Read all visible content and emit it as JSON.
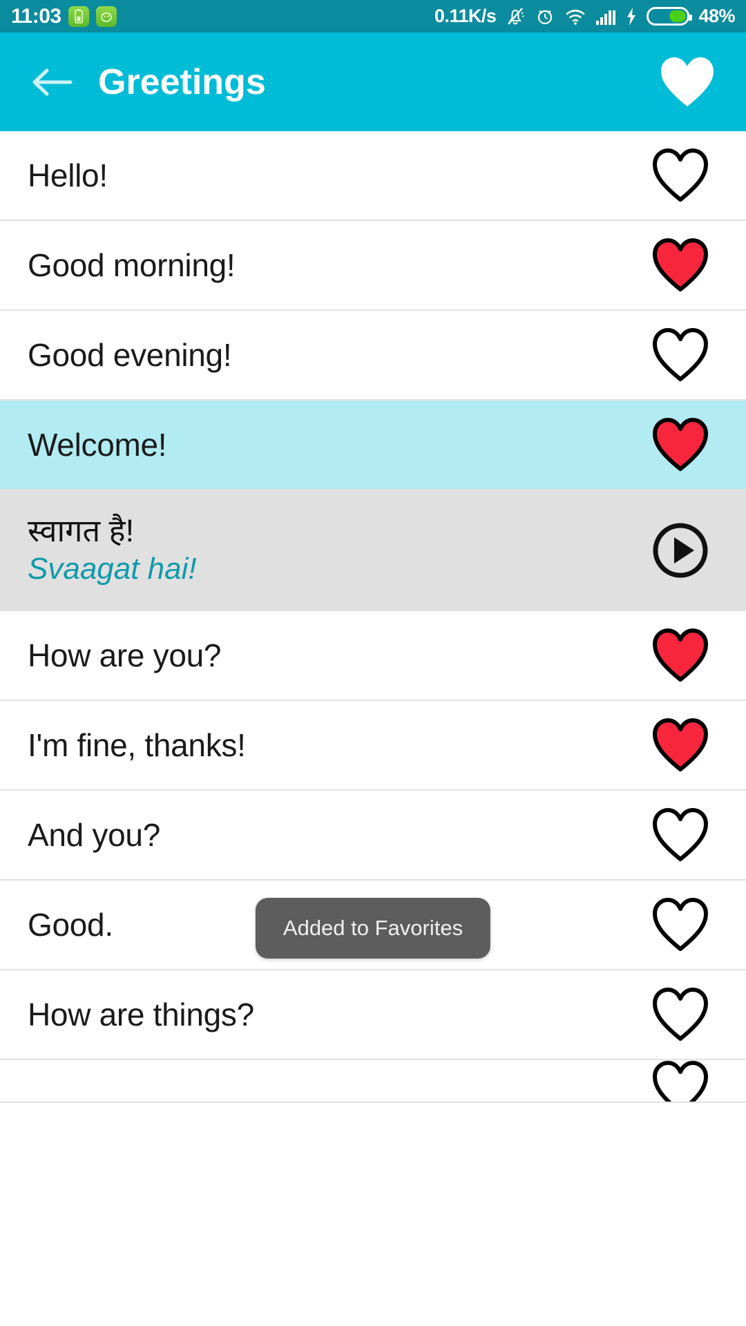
{
  "statusbar": {
    "time": "11:03",
    "network_speed": "0.11K/s",
    "battery_percent": "48%",
    "icons": [
      "battery-saver-icon",
      "android-app-icon",
      "notifications-muted-icon",
      "alarm-icon",
      "wifi-icon",
      "signal-icon",
      "charging-bolt-icon",
      "battery-icon"
    ],
    "background_color": "#0a8b9e"
  },
  "appbar": {
    "title": "Greetings",
    "back_label": "←",
    "favorite_label": "♥",
    "background_color": "#00bcd6"
  },
  "colors": {
    "accent": "#00bcd6",
    "selected_row": "#b2ebf2",
    "expanded_row": "#e0e0e0",
    "favorite_red": "#f8263c",
    "romanization_teal": "#0f9aab",
    "toast_bg": "#5d5d5d"
  },
  "list": {
    "rows": [
      {
        "text": "Hello!",
        "favorite": false,
        "state": "normal"
      },
      {
        "text": "Good morning!",
        "favorite": true,
        "state": "normal"
      },
      {
        "text": "Good evening!",
        "favorite": false,
        "state": "normal"
      },
      {
        "text": "Welcome!",
        "favorite": true,
        "state": "selected"
      },
      {
        "text": "स्वागत है!",
        "romanization": "Svaagat hai!",
        "state": "expanded",
        "play": true
      },
      {
        "text": "How are you?",
        "favorite": true,
        "state": "normal"
      },
      {
        "text": "I'm fine, thanks!",
        "favorite": true,
        "state": "normal"
      },
      {
        "text": "And you?",
        "favorite": false,
        "state": "normal"
      },
      {
        "text": "Good.",
        "favorite": false,
        "state": "normal"
      },
      {
        "text": "How are things?",
        "favorite": false,
        "state": "normal"
      },
      {
        "text": "",
        "favorite": false,
        "state": "partial"
      }
    ]
  },
  "toast": {
    "message": "Added to Favorites"
  }
}
